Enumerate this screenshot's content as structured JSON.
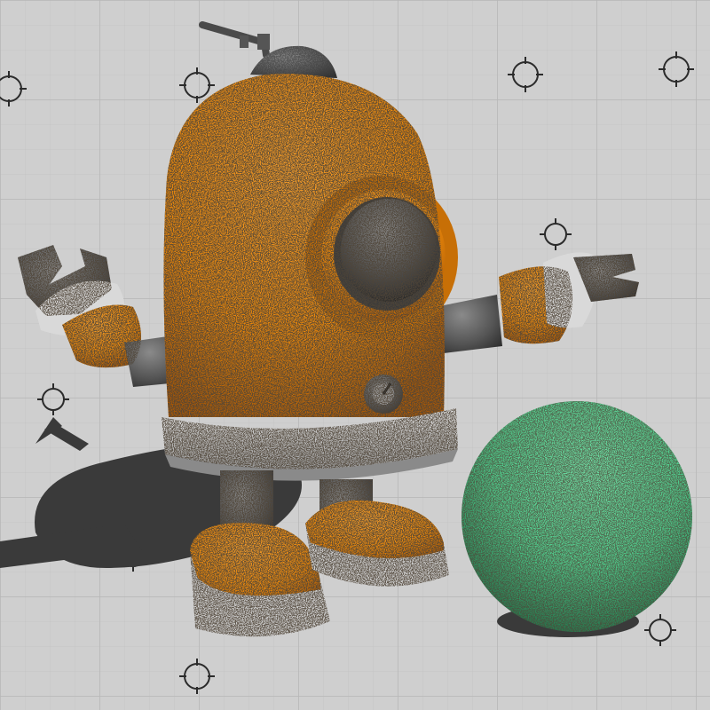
{
  "scene": {
    "subjects": [
      "robot",
      "sphere",
      "grid-floor"
    ],
    "colors": {
      "background": "#cfcfcf",
      "grid_line": "#b9b9b9",
      "grid_minor": "#c6c6c6",
      "marker": "#2b2b2b",
      "shadow": "#3a3a3a",
      "robot_body": "#e8860a",
      "robot_body_dark": "#b05e05",
      "dark_metal": "#4a4a4a",
      "metal_light": "#7a7a7a",
      "collar": "#d9d9d9",
      "sphere": "#4ec98a",
      "sphere_dark": "#1f7a4c",
      "speckle": "#1a1a1a"
    },
    "icons": [
      "crosshair-marker-icon",
      "gauge-dial-icon",
      "antenna-icon"
    ]
  }
}
